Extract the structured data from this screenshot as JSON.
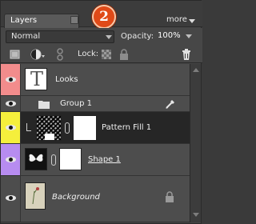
{
  "panel": {
    "tab_label": "Layers",
    "badge_number": "2",
    "more_label": "more"
  },
  "options": {
    "blend_mode": "Normal",
    "opacity_label": "Opacity:",
    "opacity_value": "100%"
  },
  "tools": {
    "lock_label": "Lock:",
    "icons": [
      "new-layer-icon",
      "adjustment-layer-icon",
      "link-layers-icon",
      "lock-transparency-icon",
      "lock-all-icon",
      "trash-icon"
    ]
  },
  "layers": [
    {
      "name": "Looks",
      "type": "text",
      "color_tag": "#f28c8c"
    },
    {
      "name": "Group 1",
      "type": "group",
      "color_tag": "none"
    },
    {
      "name": "Pattern Fill 1",
      "type": "fill",
      "color_tag": "#f5ef3c",
      "selected": true
    },
    {
      "name": "Shape 1",
      "type": "shape",
      "color_tag": "#b78cf0"
    },
    {
      "name": "Background",
      "type": "background",
      "color_tag": "none",
      "locked": true
    }
  ],
  "colors": {
    "badge": "#e04a18",
    "selected_row": "#262626",
    "tag_red": "#f28c8c",
    "tag_yellow": "#f5ef3c",
    "tag_violet": "#b78cf0"
  }
}
